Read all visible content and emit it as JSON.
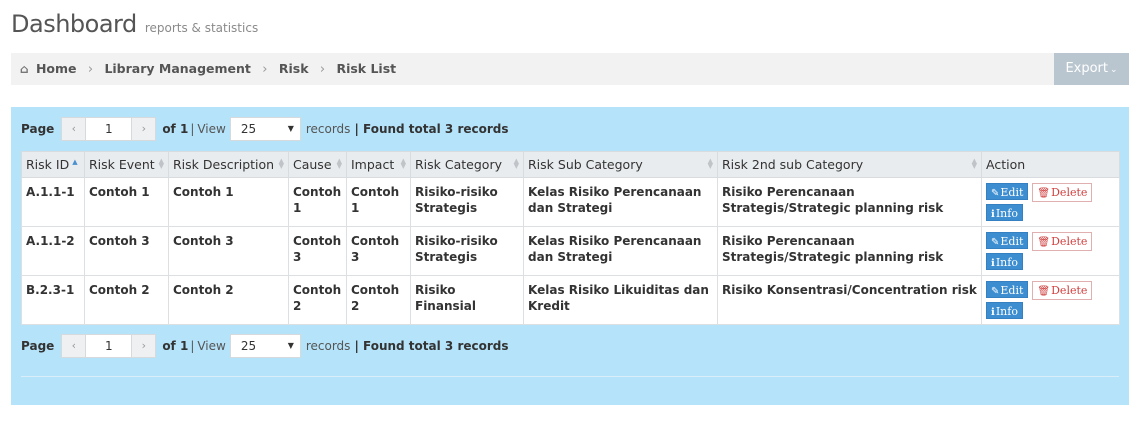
{
  "header": {
    "title": "Dashboard",
    "subtitle": "reports & statistics"
  },
  "breadcrumb": {
    "home_icon": "home-icon",
    "items": [
      "Home",
      "Library Management",
      "Risk",
      "Risk List"
    ],
    "separator": "›"
  },
  "export": {
    "label": "Export",
    "chevron": "⌄"
  },
  "pager": {
    "page_label": "Page",
    "prev": "‹",
    "next": "›",
    "current_page": "1",
    "of_label": "of 1",
    "pipe": "|",
    "view_label": "View",
    "view_value": "25",
    "records_label": "records",
    "found_label": "| Found total 3 records"
  },
  "table": {
    "columns": [
      "Risk ID",
      "Risk Event",
      "Risk Description",
      "Cause",
      "Impact",
      "Risk Category",
      "Risk Sub Category",
      "Risk 2nd sub Category",
      "Action"
    ],
    "rows": [
      {
        "id": "A.1.1-1",
        "event": "Contoh 1",
        "description": "Contoh 1",
        "cause": "Contoh 1",
        "impact": "Contoh 1",
        "category": "Risiko-risiko Strategis",
        "sub_category": "Kelas Risiko Perencanaan dan Strategi",
        "second_sub": "Risiko Perencanaan Strategis/Strategic planning risk"
      },
      {
        "id": "A.1.1-2",
        "event": "Contoh 3",
        "description": "Contoh 3",
        "cause": "Contoh 3",
        "impact": "Contoh 3",
        "category": "Risiko-risiko Strategis",
        "sub_category": "Kelas Risiko Perencanaan dan Strategi",
        "second_sub": "Risiko Perencanaan Strategis/Strategic planning risk"
      },
      {
        "id": "B.2.3-1",
        "event": "Contoh 2",
        "description": "Contoh 2",
        "cause": "Contoh 2",
        "impact": "Contoh 2",
        "category": "Risiko Finansial",
        "sub_category": "Kelas Risiko Likuiditas dan Kredit",
        "second_sub": "Risiko Konsentrasi/Concentration risk"
      }
    ],
    "actions": {
      "edit": "Edit",
      "delete": "Delete",
      "info": "Info"
    }
  },
  "icons": {
    "edit": "pencil-icon",
    "delete": "trash-icon",
    "info": "info-icon",
    "sort_asc": "sort-asc-icon",
    "sort": "sort-icon"
  },
  "colors": {
    "panel_bg": "#b5e3f9",
    "primary": "#3c8ed1",
    "danger": "#d04040",
    "export_bg": "#b9c6cf"
  }
}
